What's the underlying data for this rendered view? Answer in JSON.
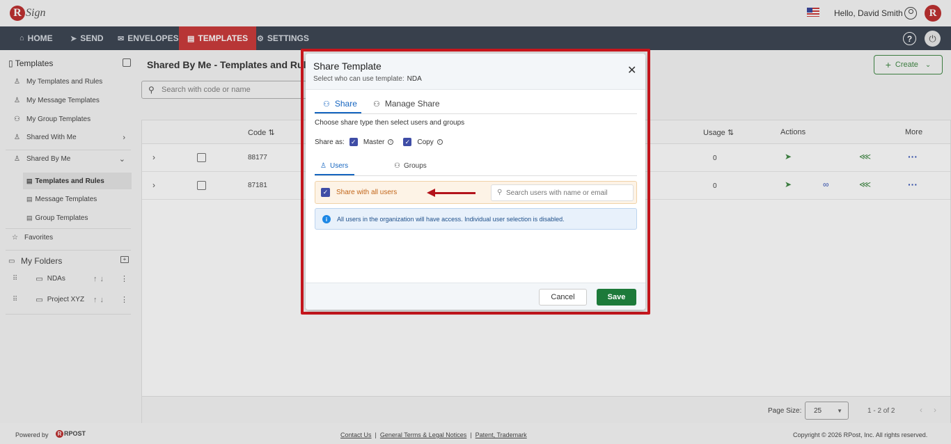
{
  "header": {
    "logo_text": "Sign",
    "greeting": "Hello, David Smith"
  },
  "nav": {
    "items": [
      {
        "label": "HOME",
        "icon": "home-icon"
      },
      {
        "label": "SEND",
        "icon": "send-icon"
      },
      {
        "label": "ENVELOPES",
        "icon": "envelope-icon"
      },
      {
        "label": "TEMPLATES",
        "icon": "document-icon",
        "active": true
      },
      {
        "label": "SETTINGS",
        "icon": "gear-icon"
      }
    ]
  },
  "sidebar": {
    "title": "Templates",
    "items": [
      {
        "label": "My Templates and Rules"
      },
      {
        "label": "My Message Templates"
      },
      {
        "label": "My Group Templates"
      },
      {
        "label": "Shared With Me"
      },
      {
        "label": "Shared By Me"
      }
    ],
    "sub_items": [
      {
        "label": "Templates and Rules",
        "active": true
      },
      {
        "label": "Message Templates"
      },
      {
        "label": "Group Templates"
      }
    ],
    "favorites": "Favorites",
    "folders_title": "My Folders",
    "folders": [
      {
        "label": "NDAs"
      },
      {
        "label": "Project XYZ"
      }
    ]
  },
  "main": {
    "title": "Shared By Me - Templates and Rules",
    "search_placeholder": "Search with code or name",
    "create_label": "Create",
    "columns": {
      "code": "Code",
      "usage": "Usage",
      "actions": "Actions",
      "more": "More"
    },
    "rows": [
      {
        "code": "88177",
        "usage": "0",
        "has_link": false
      },
      {
        "code": "87181",
        "usage": "0",
        "has_link": true
      }
    ],
    "page_size_label": "Page Size:",
    "page_size": "25",
    "range": "1 - 2 of 2"
  },
  "footer": {
    "powered_by": "Powered by",
    "brand": "RPOST",
    "links": [
      "Contact Us",
      "General Terms & Legal Notices",
      "Patent, Trademark"
    ],
    "copyright": "Copyright © 2026 RPost, Inc. All rights reserved."
  },
  "modal": {
    "title": "Share Template",
    "subtitle": "Select who can use template:",
    "template_name": "NDA",
    "tabs": [
      {
        "label": "Share"
      },
      {
        "label": "Manage Share"
      }
    ],
    "instruction": "Choose share type then select users and groups",
    "share_as_label": "Share as:",
    "share_options": [
      {
        "label": "Master",
        "checked": true
      },
      {
        "label": "Copy",
        "checked": true
      }
    ],
    "subtabs": [
      {
        "label": "Users"
      },
      {
        "label": "Groups"
      }
    ],
    "share_all_label": "Share with all users",
    "share_all_checked": true,
    "user_search_placeholder": "Search users with name or email",
    "info_note": "All users in the organization will have access. Individual user selection is disabled.",
    "cancel_label": "Cancel",
    "save_label": "Save"
  },
  "colors": {
    "nav_bg": "#2a3442",
    "active_nav": "#c62828",
    "accent_blue": "#1565c0",
    "save_green": "#1d7a3a",
    "highlight_red": "#c8161d"
  }
}
